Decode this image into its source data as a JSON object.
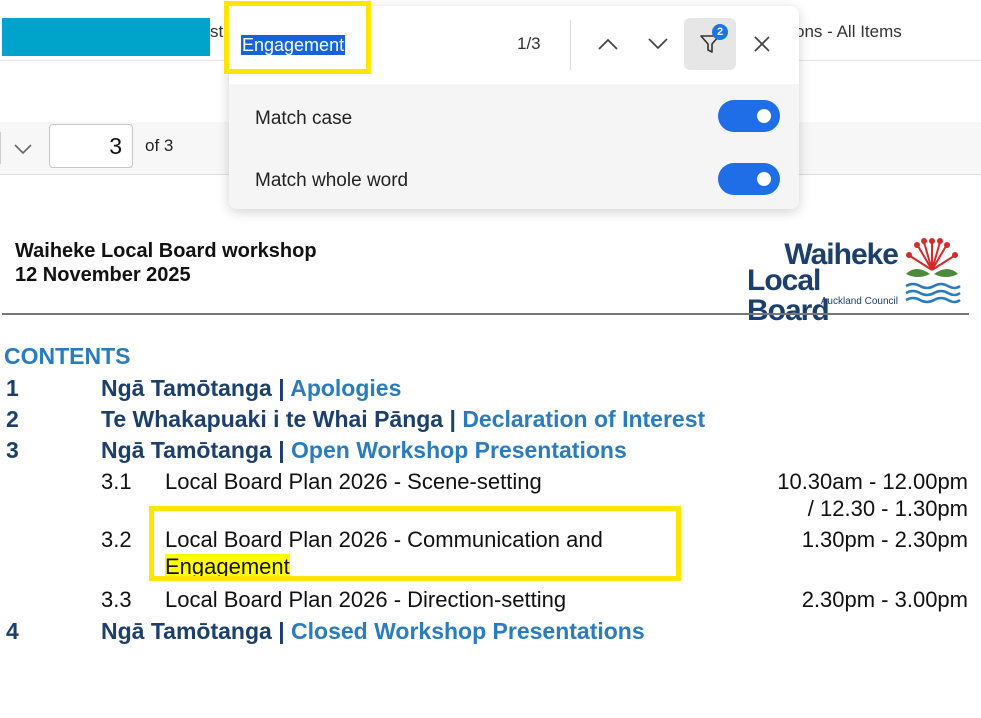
{
  "tabs": {
    "tab1_fragment": "st",
    "tab2_label": "ons - All Items"
  },
  "pdf_toolbar": {
    "page_value": "3",
    "page_of": "of 3"
  },
  "find": {
    "query": "Engagement",
    "match_count": "1/3",
    "filter_badge": "2",
    "options": [
      {
        "label": "Match case",
        "enabled": true
      },
      {
        "label": "Match whole word",
        "enabled": true
      }
    ],
    "icons": [
      "chevron-up-icon",
      "chevron-down-icon",
      "filter-icon",
      "close-icon"
    ]
  },
  "document": {
    "title_line1": "Waiheke Local Board workshop",
    "title_line2": "12 November 2025",
    "logo": {
      "line1": "Waiheke",
      "line2": "Local Board",
      "line3": "Auckland Council"
    },
    "contents_heading": "CONTENTS",
    "items": [
      {
        "num": "1",
        "maori": "Ngā Tamōtanga",
        "sep": " | ",
        "english": "Apologies"
      },
      {
        "num": "2",
        "maori": "Te Whakapuaki i te Whai Pānga",
        "sep": " | ",
        "english": "Declaration of Interest"
      },
      {
        "num": "3",
        "maori": "Ngā Tamōtanga",
        "sep": " | ",
        "english": "Open Workshop Presentations"
      },
      {
        "num": "4",
        "maori": "Ngā Tamōtanga",
        "sep": " | ",
        "english": "Closed Workshop Presentations"
      }
    ],
    "subitems": [
      {
        "num": "3.1",
        "title": "Local Board Plan 2026 - Scene-setting",
        "time": "10.30am - 12.00pm",
        "time2": "/ 12.30 - 1.30pm"
      },
      {
        "num": "3.2",
        "title": "Local Board Plan 2026 - Communication and",
        "title2": "Engagement",
        "time": "1.30pm - 2.30pm"
      },
      {
        "num": "3.3",
        "title": "Local Board Plan 2026 - Direction-setting",
        "time": "2.30pm - 3.00pm"
      }
    ]
  },
  "colors": {
    "accent_blue": "#1f6ee8",
    "doc_dark_blue": "#1c3f6e",
    "doc_light_blue": "#2b7bbf",
    "highlight_yellow": "#ffff00",
    "annotation_yellow": "#ffe600"
  }
}
